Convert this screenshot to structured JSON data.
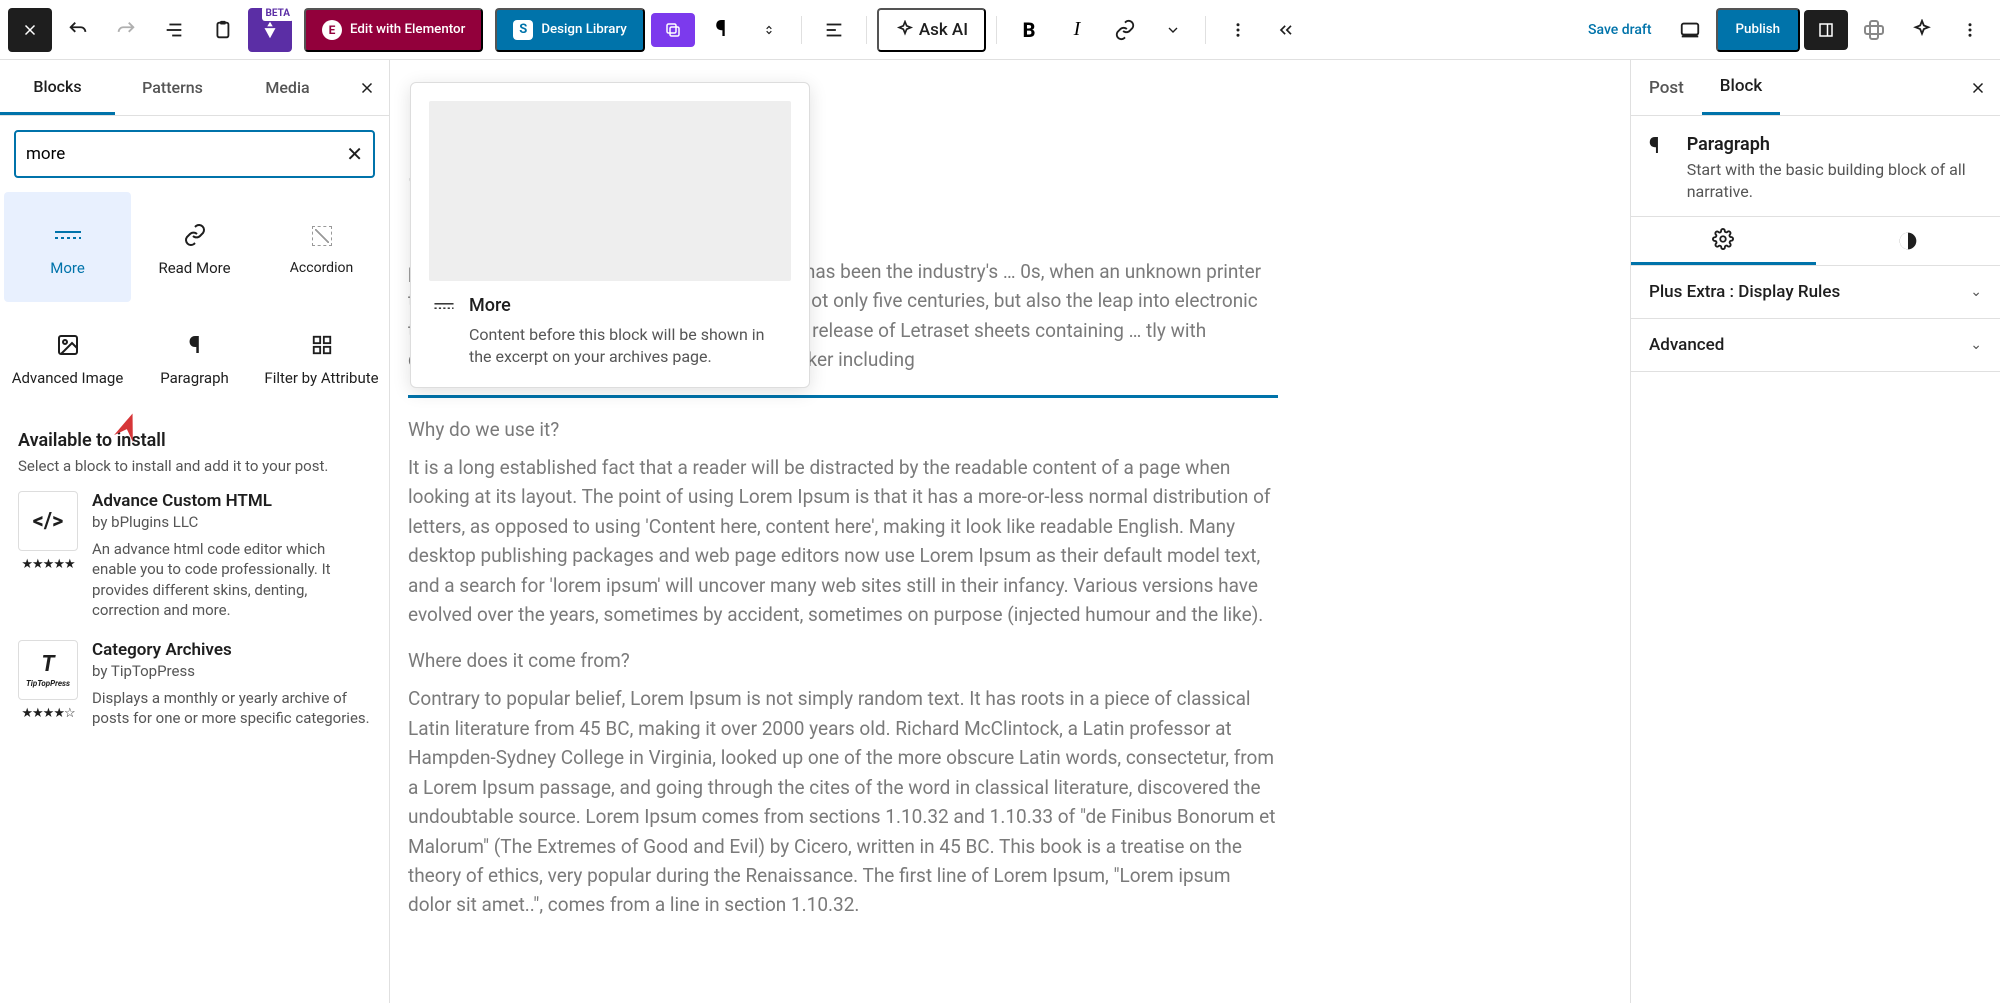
{
  "topbar": {
    "elementor": "Edit with Elementor",
    "design": "Design Library",
    "askai": "Ask AI",
    "savedraft": "Save draft",
    "publish": "Publish",
    "beta": "BETA"
  },
  "left": {
    "tabs": {
      "blocks": "Blocks",
      "patterns": "Patterns",
      "media": "Media"
    },
    "search": {
      "value": "more"
    },
    "blocks": {
      "more": "More",
      "readmore": "Read More",
      "accordion": "Accordion",
      "advimg": "Advanced Image",
      "para": "Paragraph",
      "filter": "Filter by Attribute"
    },
    "avail": {
      "title": "Available to install",
      "sub": "Select a block to install and add it to your post.",
      "i1": {
        "name": "Advance Custom HTML",
        "by": "by bPlugins LLC",
        "desc": "An advance html code editor which enable you to code professionally. It provides different skins, denting, correction and more.",
        "stars": "★★★★★"
      },
      "i2": {
        "name": "Category Archives",
        "by": "by TipTopPress",
        "desc": "Displays a monthly or yearly archive of posts for one or more specific categories.",
        "stars": "★★★★☆",
        "logo": "TipTopPress"
      }
    }
  },
  "preview": {
    "title": "More",
    "desc": "Content before this block will be shown in the excerpt on your archives page."
  },
  "editor": {
    "p1": "printing and typesetting industry. Lorem Ipsum has been the industry's … 0s, when an unknown printer took a galley of type and scrambled it to … ved not only five centuries, but also the leap into electronic typesetting, … popularised in the 1960s with the release of Letraset sheets containing … tly with desktop publishing software like Aldus PageMaker including",
    "h2": "Why do we use it?",
    "p2": "It is a long established fact that a reader will be distracted by the readable content of a page when looking at its layout. The point of using Lorem Ipsum is that it has a more-or-less normal distribution of letters, as opposed to using 'Content here, content here', making it look like readable English. Many desktop publishing packages and web page editors now use Lorem Ipsum as their default model text, and a search for 'lorem ipsum' will uncover many web sites still in their infancy. Various versions have evolved over the years, sometimes by accident, sometimes on purpose (injected humour and the like).",
    "h3": "Where does it come from?",
    "p3": "Contrary to popular belief, Lorem Ipsum is not simply random text. It has roots in a piece of classical Latin literature from 45 BC, making it over 2000 years old. Richard McClintock, a Latin professor at Hampden-Sydney College in Virginia, looked up one of the more obscure Latin words, consectetur, from a Lorem Ipsum passage, and going through the cites of the word in classical literature, discovered the undoubtable source. Lorem Ipsum comes from sections 1.10.32 and 1.10.33 of \"de Finibus Bonorum et Malorum\" (The Extremes of Good and Evil) by Cicero, written in 45 BC. This book is a treatise on the theory of ethics, very popular during the Renaissance. The first line of Lorem Ipsum, \"Lorem ipsum dolor sit amet..\", comes from a line in section 1.10.32."
  },
  "right": {
    "tabs": {
      "post": "Post",
      "block": "Block"
    },
    "block": {
      "title": "Paragraph",
      "desc": "Start with the basic building block of all narrative."
    },
    "panels": {
      "plus": "Plus Extra : Display Rules",
      "adv": "Advanced"
    }
  }
}
